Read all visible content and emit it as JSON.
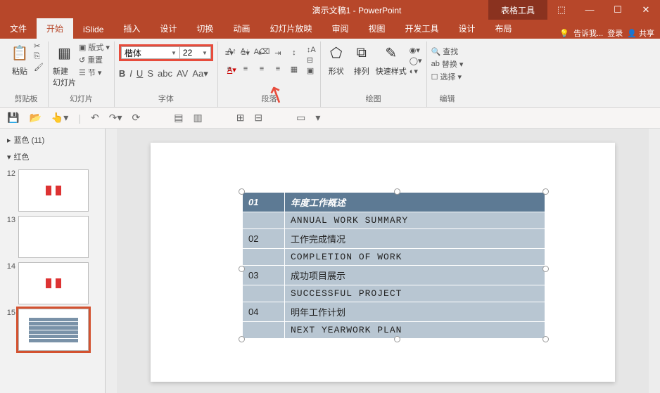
{
  "titlebar": {
    "title": "演示文稿1 - PowerPoint",
    "context": "表格工具"
  },
  "menubar": {
    "tabs": [
      "文件",
      "开始",
      "iSlide",
      "插入",
      "设计",
      "切换",
      "动画",
      "幻灯片放映",
      "审阅",
      "视图",
      "开发工具"
    ],
    "context_tabs": [
      "设计",
      "布局"
    ],
    "active": "开始",
    "tell_me": "告诉我...",
    "login": "登录",
    "share": "共享"
  },
  "ribbon": {
    "clipboard": {
      "paste": "粘贴",
      "label": "剪贴板"
    },
    "slides": {
      "new_slide": "新建\n幻灯片",
      "layout": "版式",
      "reset": "重置",
      "section": "节",
      "label": "幻灯片"
    },
    "font": {
      "name": "楷体",
      "size": "22",
      "label": "字体"
    },
    "paragraph": {
      "label": "段落"
    },
    "drawing": {
      "shapes": "形状",
      "arrange": "排列",
      "quick_styles": "快速样式",
      "label": "绘图"
    },
    "editing": {
      "find": "查找",
      "replace": "替换",
      "select": "选择",
      "label": "编辑"
    }
  },
  "nav": {
    "sections": [
      {
        "collapsed": true,
        "name": "蓝色 (11)"
      },
      {
        "collapsed": false,
        "name": "红色"
      }
    ],
    "slides": [
      {
        "num": "12",
        "type": "lantern"
      },
      {
        "num": "13",
        "type": "blank"
      },
      {
        "num": "14",
        "type": "lantern"
      },
      {
        "num": "15",
        "type": "table",
        "selected": true
      }
    ]
  },
  "table": {
    "rows": [
      {
        "num": "01",
        "cn": "年度工作概述",
        "header": true
      },
      {
        "num": "",
        "cn": "ANNUAL WORK SUMMARY",
        "en": true
      },
      {
        "num": "02",
        "cn": "工作完成情况"
      },
      {
        "num": "",
        "cn": "COMPLETION OF WORK",
        "en": true
      },
      {
        "num": "03",
        "cn": "成功项目展示"
      },
      {
        "num": "",
        "cn": "SUCCESSFUL PROJECT",
        "en": true
      },
      {
        "num": "04",
        "cn": "明年工作计划"
      },
      {
        "num": "",
        "cn": "NEXT YEARWORK PLAN",
        "en": true
      }
    ]
  }
}
